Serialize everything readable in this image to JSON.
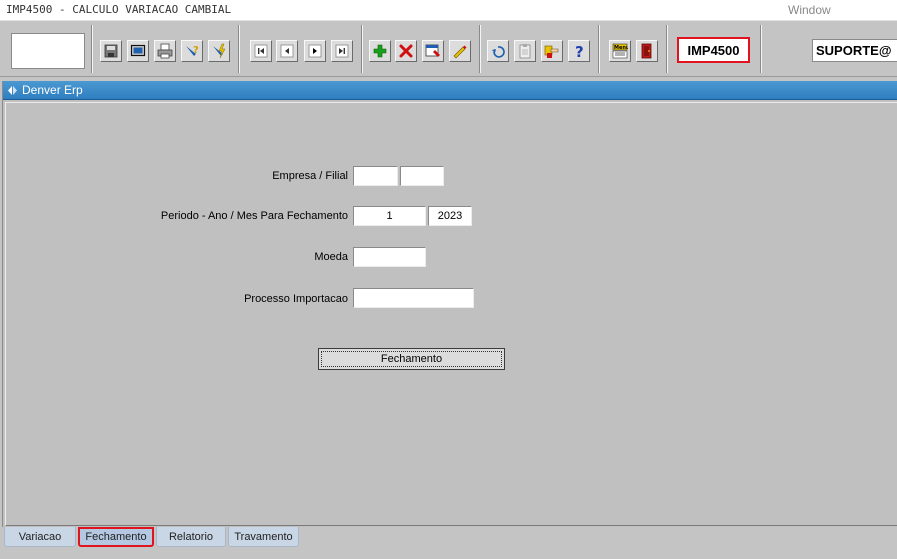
{
  "window": {
    "title": "IMP4500 - CALCULO VARIACAO CAMBIAL",
    "menu_window": "Window"
  },
  "toolbar": {
    "form_code": "IMP4500",
    "user": "SUPORTE@",
    "buttons": [
      {
        "name": "save-icon"
      },
      {
        "name": "window-icon"
      },
      {
        "name": "print-icon"
      },
      {
        "name": "query-icon"
      },
      {
        "name": "execute-query-icon"
      },
      {
        "name": "first-record-icon"
      },
      {
        "name": "previous-record-icon"
      },
      {
        "name": "next-record-icon"
      },
      {
        "name": "last-record-icon"
      },
      {
        "name": "insert-record-icon"
      },
      {
        "name": "delete-record-icon"
      },
      {
        "name": "list-values-icon"
      },
      {
        "name": "edit-icon"
      },
      {
        "name": "undo-icon"
      },
      {
        "name": "clipboard-icon"
      },
      {
        "name": "point-hand-icon"
      },
      {
        "name": "help-icon"
      },
      {
        "name": "menu-icon"
      },
      {
        "name": "exit-icon"
      }
    ]
  },
  "frame": {
    "title": "Denver Erp"
  },
  "form": {
    "empresa_label": "Empresa / Filial",
    "empresa_value": "",
    "filial_value": "",
    "periodo_label": "Periodo - Ano / Mes Para Fechamento",
    "mes_value": "1",
    "ano_value": "2023",
    "moeda_label": "Moeda",
    "moeda_value": "",
    "processo_label": "Processo Importacao",
    "processo_value": "",
    "button_label": "Fechamento"
  },
  "tabs": [
    {
      "label": "Variacao",
      "active": false
    },
    {
      "label": "Fechamento",
      "active": true
    },
    {
      "label": "Relatorio",
      "active": false
    },
    {
      "label": "Travamento",
      "active": false
    }
  ],
  "colors": {
    "highlight": "#e0141e",
    "title_bar": "#3a88c8",
    "background": "#c0c0c0"
  }
}
